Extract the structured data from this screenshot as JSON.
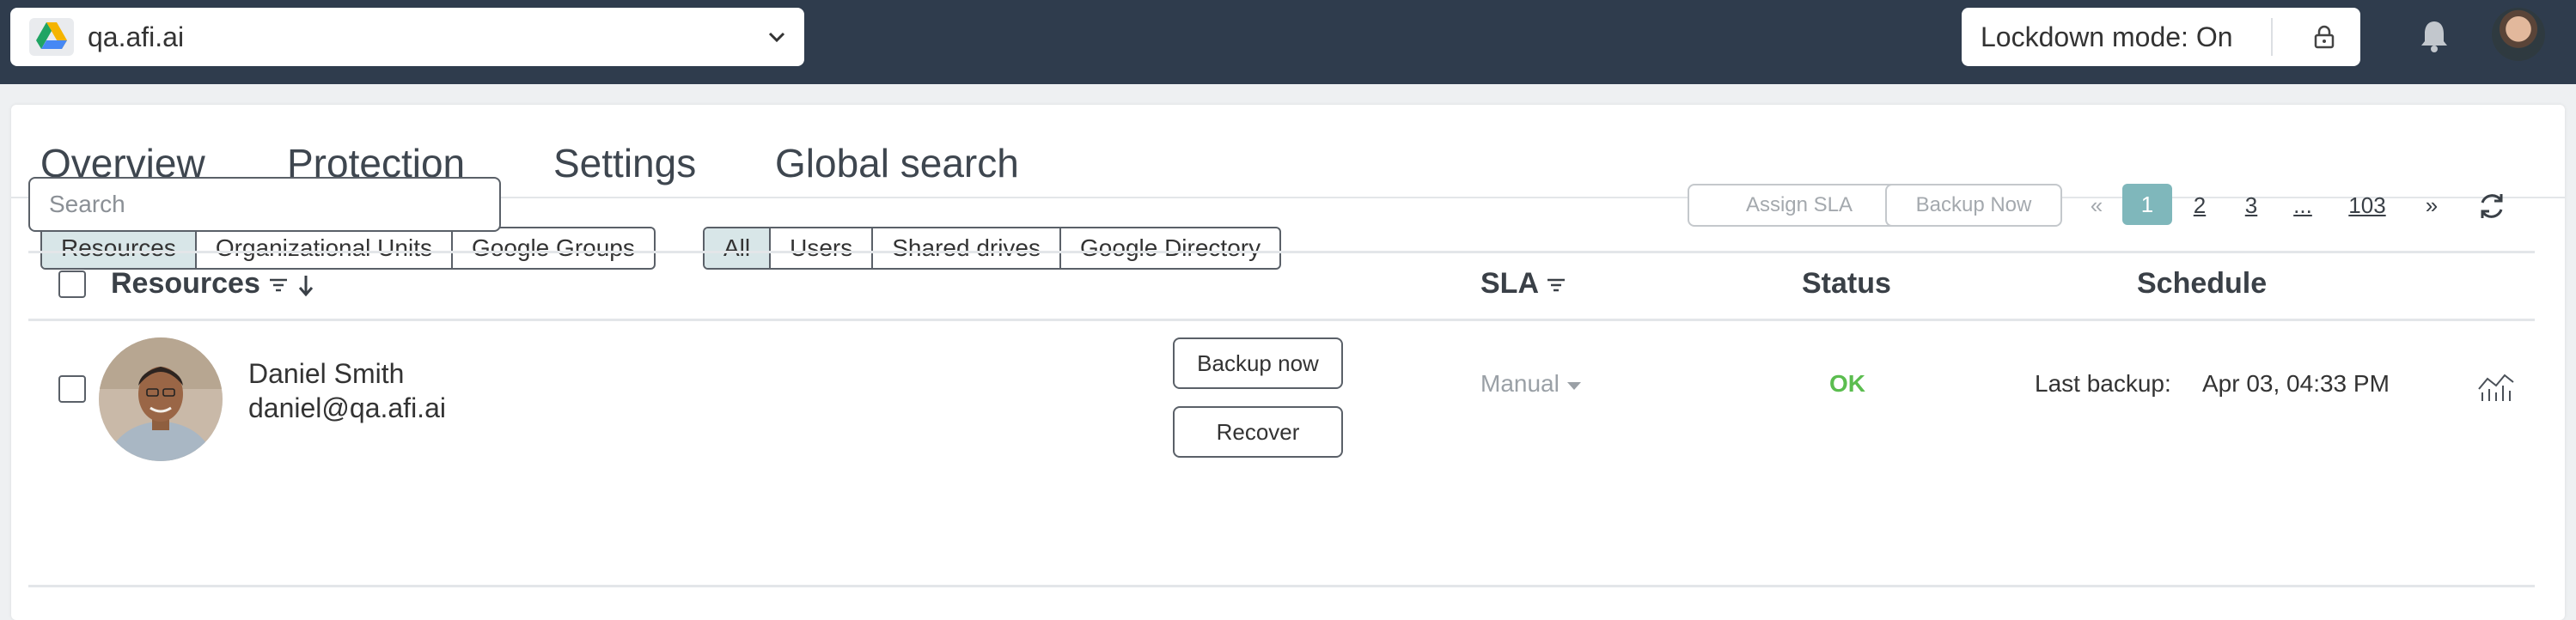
{
  "tenant": {
    "name": "qa.afi.ai"
  },
  "lockdown": {
    "label": "Lockdown mode: On"
  },
  "tabs": [
    {
      "label": "Overview"
    },
    {
      "label": "Protection"
    },
    {
      "label": "Settings"
    },
    {
      "label": "Global search"
    }
  ],
  "scope_filter": [
    "Resources",
    "Organizational Units",
    "Google Groups"
  ],
  "type_filter": [
    "All",
    "Users",
    "Shared drives",
    "Google Directory"
  ],
  "search": {
    "placeholder": "Search"
  },
  "actions": {
    "assign_sla": "Assign SLA",
    "backup_now": "Backup Now"
  },
  "pagination": {
    "prev": "«",
    "pages": [
      "1",
      "2",
      "3",
      "...",
      "103"
    ],
    "next": "»",
    "current": "1"
  },
  "table": {
    "columns": {
      "resources": "Resources",
      "sla": "SLA",
      "status": "Status",
      "schedule": "Schedule"
    },
    "rows": [
      {
        "name": "Daniel Smith",
        "email": "daniel@qa.afi.ai",
        "backup_label": "Backup now",
        "recover_label": "Recover",
        "sla": "Manual",
        "status": "OK",
        "last_backup_label": "Last backup:",
        "last_backup_value": "Apr 03, 04:33 PM"
      }
    ]
  },
  "colors": {
    "topbar": "#2f3c4d",
    "accent": "#58a6a8",
    "status_ok": "#5bbd4f",
    "page_current": "#7fb7bb"
  }
}
